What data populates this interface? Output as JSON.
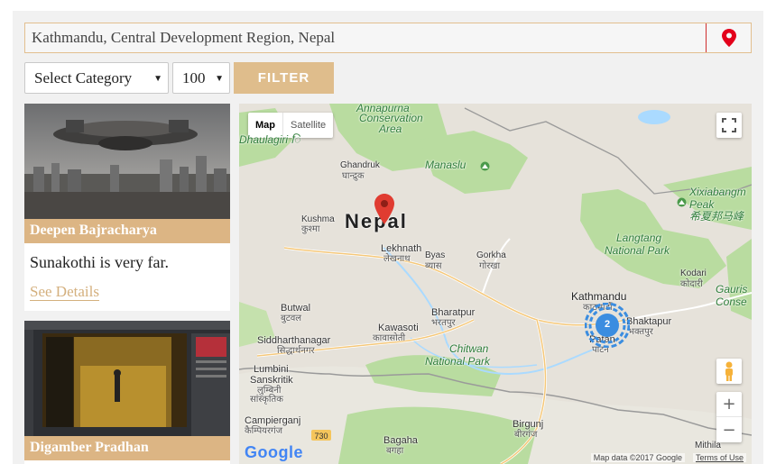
{
  "search": {
    "value": "Kathmandu, Central Development Region, Nepal"
  },
  "filters": {
    "category": "Select Category",
    "count": "100",
    "filter_label": "FILTER"
  },
  "cards": [
    {
      "name": "Deepen Bajracharya",
      "desc": "Sunakothi is very far.",
      "link": "See Details"
    },
    {
      "name": "Digamber Pradhan"
    }
  ],
  "map": {
    "type_map": "Map",
    "type_satellite": "Satellite",
    "cluster_count": "2",
    "attribution": "Map data ©2017 Google",
    "terms": "Terms of Use",
    "logo": "Google",
    "labels": {
      "annapurna_1": "Annapurna",
      "annapurna_2": "Conservation",
      "annapurna_3": "Area",
      "dhaulagiri": "Dhaulagiri ि",
      "ghandruk": "Ghandruk",
      "ghandruk_dev": "घान्द्रुक",
      "manaslu": "Manaslu",
      "nepal": "Nepal",
      "kushma": "Kushma",
      "kushma_dev": "कुश्मा",
      "lekhnath": "Lekhnath",
      "lekhnath_dev": "लेखनाथ",
      "byas": "Byas",
      "byas_dev": "ब्यास",
      "gorkha": "Gorkha",
      "gorkha_dev": "गोरखा",
      "xixiabangma": "Xixiabangm",
      "xixiabangma_2": "Peak",
      "xixiabangma_dev": "希夏邦马峰",
      "langtang_1": "Langtang",
      "langtang_2": "National Park",
      "kodari": "Kodari",
      "kodari_dev": "कोदारी",
      "gaurishankar_1": "Gauris",
      "gaurishankar_2": "Conse",
      "kathmandu": "Kathmandu",
      "kathmandu_dev": "काठमाडौं",
      "bhaktapur": "Bhaktapur",
      "bhaktapur_dev": "भक्तपुर",
      "patan": "Patan",
      "patan_dev": "पाटन",
      "butwal": "Butwal",
      "butwal_dev": "बुटवल",
      "kawasoti": "Kawasoti",
      "kawasoti_dev": "कावासोती",
      "bharatpur": "Bharatpur",
      "bharatpur_dev": "भरतपुर",
      "chitwan_1": "Chitwan",
      "chitwan_2": "National Park",
      "siddharthanagar": "Siddharthanagar",
      "siddharthanagar_dev": "सिद्धार्थनगर",
      "lumbini_1": "Lumbini",
      "lumbini_2": "Sanskritik",
      "lumbini_dev_1": "लुम्बिनी",
      "lumbini_dev_2": "सांस्कृतिक",
      "campierganj": "Campierganj",
      "campierganj_dev": "कैम्पियरगंज",
      "birgunj": "Birgunj",
      "birgunj_dev": "बीरगंज",
      "bagaha": "Bagaha",
      "bagaha_dev": "बगहा",
      "mithila": "Mithila",
      "road_730": "730"
    }
  },
  "colors": {
    "accent": "#dfbd8c",
    "marker": "#e03c31",
    "cluster": "#3b8de0",
    "park": "#b9dca0"
  },
  "icons": {
    "location": "location-pin-icon",
    "fullscreen": "fullscreen-icon",
    "pegman": "pegman-icon",
    "zoom_in": "zoom-in-icon",
    "zoom_out": "zoom-out-icon"
  }
}
